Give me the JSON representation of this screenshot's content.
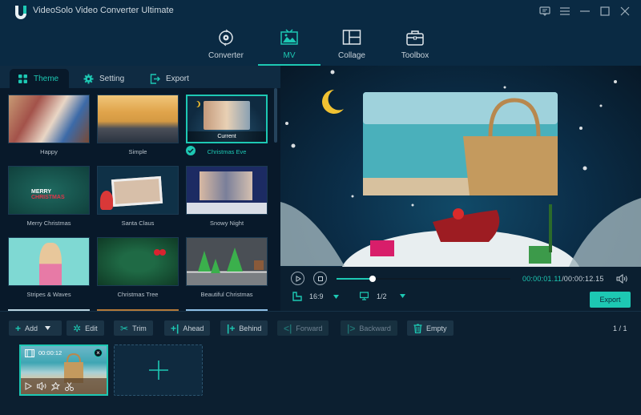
{
  "app": {
    "title": "VideoSolo Video Converter Ultimate",
    "accent_color": "#1dc8b3"
  },
  "window_controls": [
    {
      "name": "feedback-icon"
    },
    {
      "name": "menu-icon"
    },
    {
      "name": "minimize-icon"
    },
    {
      "name": "maximize-icon"
    },
    {
      "name": "close-icon"
    }
  ],
  "nav": [
    {
      "label": "Converter",
      "icon": "converter-icon",
      "active": false
    },
    {
      "label": "MV",
      "icon": "mv-icon",
      "active": true
    },
    {
      "label": "Collage",
      "icon": "collage-icon",
      "active": false
    },
    {
      "label": "Toolbox",
      "icon": "toolbox-icon",
      "active": false
    }
  ],
  "tabs": [
    {
      "label": "Theme",
      "icon": "theme-icon",
      "active": true
    },
    {
      "label": "Setting",
      "icon": "gear-icon",
      "active": false
    },
    {
      "label": "Export",
      "icon": "export-icon",
      "active": false
    }
  ],
  "themes": [
    {
      "name": "Happy"
    },
    {
      "name": "Simple"
    },
    {
      "name": "Christmas Eve",
      "selected": true,
      "tag": "Current"
    },
    {
      "name": "Merry Christmas"
    },
    {
      "name": "Santa Claus"
    },
    {
      "name": "Snowy Night"
    },
    {
      "name": "Stripes & Waves"
    },
    {
      "name": "Christmas Tree"
    },
    {
      "name": "Beautiful Christmas"
    }
  ],
  "player": {
    "current_time": "00:00:01.11",
    "total_time": "/00:00:12.15",
    "progress": 0.09,
    "aspect_ratio": "16:9",
    "resolution_scale": "1/2",
    "export_label": "Export"
  },
  "toolbar": {
    "buttons": [
      {
        "label": "Add",
        "icon": "plus-icon",
        "glyph": "+",
        "enabled": true
      },
      {
        "label": "Edit",
        "icon": "magic-wand-icon",
        "glyph": "✲",
        "enabled": true
      },
      {
        "label": "Trim",
        "icon": "scissors-icon",
        "glyph": "✂",
        "enabled": true
      },
      {
        "label": "Ahead",
        "icon": "insert-ahead-icon",
        "glyph": "+|",
        "enabled": true
      },
      {
        "label": "Behind",
        "icon": "insert-behind-icon",
        "glyph": "|+",
        "enabled": true
      },
      {
        "label": "Forward",
        "icon": "move-forward-icon",
        "glyph": "<|",
        "enabled": false
      },
      {
        "label": "Backward",
        "icon": "move-backward-icon",
        "glyph": "|>",
        "enabled": false
      },
      {
        "label": "Empty",
        "icon": "trash-icon",
        "glyph": "🗑",
        "enabled": true
      }
    ],
    "page_indicator": "1 / 1"
  },
  "timeline": {
    "clips": [
      {
        "duration": "00:00:12"
      }
    ]
  }
}
